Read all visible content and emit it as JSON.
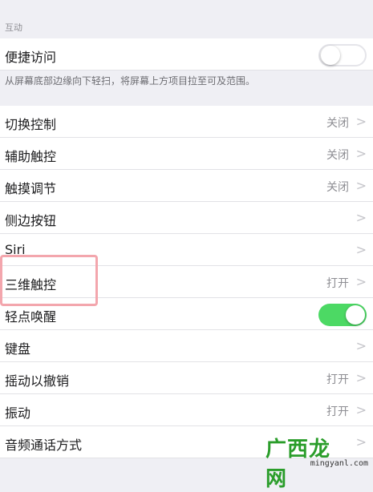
{
  "section": {
    "title": "互动"
  },
  "reachability": {
    "label": "便捷访问",
    "toggle": "off",
    "note": "从屏幕底部边缘向下轻扫，将屏幕上方项目拉至可及范围。"
  },
  "rows": [
    {
      "label": "切换控制",
      "value": "关闭",
      "chevron": ">"
    },
    {
      "label": "辅助触控",
      "value": "关闭",
      "chevron": ">"
    },
    {
      "label": "触摸调节",
      "value": "关闭",
      "chevron": ">"
    },
    {
      "label": "侧边按钮",
      "value": "",
      "chevron": ">"
    },
    {
      "label": "Siri",
      "value": "",
      "chevron": ">"
    },
    {
      "label": "三维触控",
      "value": "打开",
      "chevron": ">"
    },
    {
      "label": "轻点唤醒",
      "toggle": "on"
    },
    {
      "label": "键盘",
      "value": "",
      "chevron": ">"
    },
    {
      "label": "摇动以撤销",
      "value": "打开",
      "chevron": ">"
    },
    {
      "label": "振动",
      "value": "打开",
      "chevron": ">"
    },
    {
      "label": "音频通话方式",
      "value": "",
      "chevron": ">"
    }
  ],
  "watermark": {
    "text": "广西龙网",
    "domain": "mingyanl.com"
  },
  "colors": {
    "background": "#efeff4",
    "toggle_on": "#4cd964",
    "highlight": "#f3a6ad"
  }
}
